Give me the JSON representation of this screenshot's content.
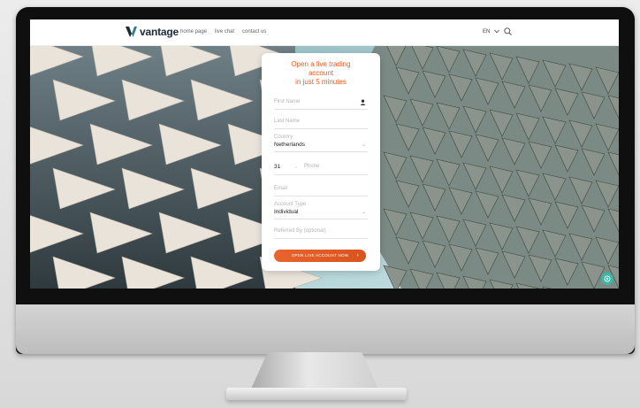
{
  "nav": {
    "brand": "vantage",
    "links": [
      "home page",
      "live chat",
      "contact us"
    ],
    "language": "EN"
  },
  "form": {
    "title_line1": "Open a live trading",
    "title_line2": "account",
    "title_line3": "in just 5 minutes",
    "first_name_placeholder": "First Name",
    "last_name_placeholder": "Last Name",
    "country_label": "Country",
    "country_value": "Netherlands",
    "phone_code": "31",
    "phone_placeholder": "Phone",
    "email_placeholder": "Email",
    "account_type_label": "Account Type",
    "account_type_value": "Individual",
    "referred_placeholder": "Referred By (optional)",
    "submit_label": "OPEN LIVE ACCOUNT NOW"
  },
  "colors": {
    "accent": "#e45e28",
    "brand_dark": "#1b2a3a",
    "chat": "#3db7a6"
  },
  "icons": [
    "user-icon",
    "chevron-down-icon",
    "search-icon",
    "chat-icon",
    "arrow-right-icon"
  ]
}
